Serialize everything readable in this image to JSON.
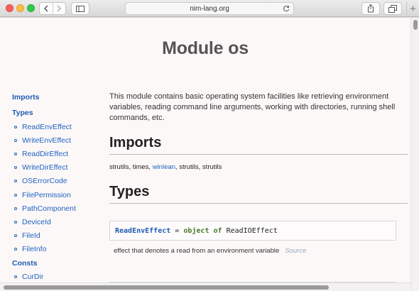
{
  "browser": {
    "url": "nim-lang.org"
  },
  "page": {
    "title": "Module os"
  },
  "sidebar": {
    "imports_label": "Imports",
    "types_label": "Types",
    "types": [
      "ReadEnvEffect",
      "WriteEnvEffect",
      "ReadDirEffect",
      "WriteDirEffect",
      "OSErrorCode",
      "FilePermission",
      "PathComponent",
      "DeviceId",
      "FileId",
      "FileInfo"
    ],
    "consts_label": "Consts",
    "consts": [
      "CurDir"
    ]
  },
  "content": {
    "intro": "This module contains basic operating system facilities like retrieving environment variables, reading command line arguments, working with directories, running shell commands, etc.",
    "imports_heading": "Imports",
    "imports_pre": "strutils, times,",
    "imports_link": "winlean",
    "imports_post": ", strutils, strutils",
    "types_heading": "Types",
    "code": {
      "ident": "ReadEnvEffect",
      "eq": " = ",
      "kw_object": "object",
      "kw_of": "of",
      "base": "ReadIOEffect"
    },
    "type_desc": "effect that denotes a read from an environment variable",
    "source_label": "Source"
  },
  "colors": {
    "link": "#1f62c0",
    "keyword": "#4a7a2a",
    "page_bg": "#fcf8f8"
  }
}
